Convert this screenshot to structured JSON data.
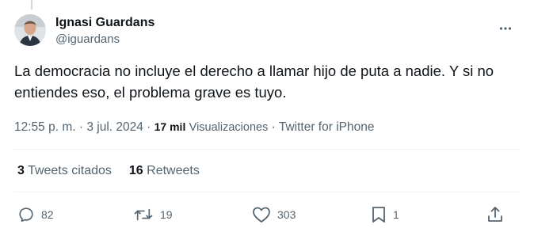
{
  "author": {
    "display_name": "Ignasi Guardans",
    "handle": "@iguardans"
  },
  "tweet": {
    "text": "La democracia no incluye el derecho a llamar hijo de puta a nadie. Y si no entiendes eso, el problema grave es tuyo."
  },
  "meta": {
    "time": "12:55 p. m.",
    "sep1": " · ",
    "date": "3 jul. 2024",
    "sep2": " · ",
    "views_count": "17 mil",
    "views_label": "Visualizaciones",
    "sep3": " · ",
    "source": "Twitter for iPhone"
  },
  "stats": {
    "quotes_count": "3",
    "quotes_label": "Tweets citados",
    "retweets_count": "16",
    "retweets_label": "Retweets"
  },
  "actions": {
    "replies": "82",
    "retweets": "19",
    "likes": "303",
    "bookmarks": "1"
  },
  "icons": [
    "more-icon",
    "reply-icon",
    "retweet-icon",
    "like-icon",
    "bookmark-icon",
    "share-icon"
  ],
  "colors": {
    "text_primary": "#0f1419",
    "text_secondary": "#536471",
    "divider": "#eff3f4"
  }
}
